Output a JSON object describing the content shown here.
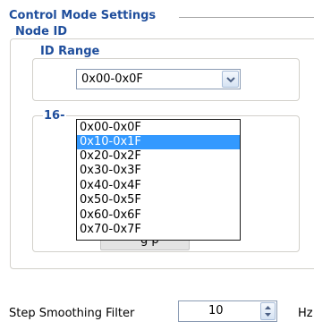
{
  "control_mode": {
    "title": "Control Mode Settings"
  },
  "node_id": {
    "title": "Node ID"
  },
  "id_range": {
    "title": "ID Range",
    "selected": "0x00-0x0F",
    "options": [
      "0x00-0x0F",
      "0x10-0x1F",
      "0x20-0x2F",
      "0x30-0x3F",
      "0x40-0x4F",
      "0x50-0x5F",
      "0x60-0x6F",
      "0x70-0x7F"
    ],
    "highlighted_index": 1
  },
  "sixteen_group": {
    "title_partial": "16-"
  },
  "obscured_button": {
    "label_fragment": "g p"
  },
  "step_smoothing": {
    "label": "Step Smoothing Filter",
    "value": "10",
    "unit_partial": "Hz"
  },
  "colors": {
    "group_title": "#1f4e9c",
    "selection": "#3399ff"
  }
}
